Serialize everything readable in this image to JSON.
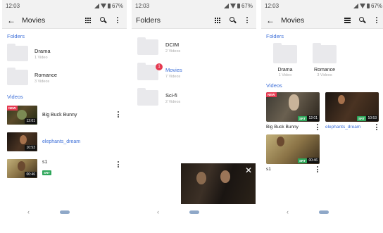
{
  "status": {
    "time": "12:03",
    "battery": "67%"
  },
  "screen1": {
    "title": "Movies",
    "folders_header": "Folders",
    "folders": [
      {
        "name": "Drama",
        "count": "1 Video"
      },
      {
        "name": "Romance",
        "count": "3 Videos"
      }
    ],
    "videos_header": "Videos",
    "videos": [
      {
        "name": "Big Buck Bunny",
        "duration": "12:01",
        "badge": "NEW",
        "srt": ""
      },
      {
        "name": "elephants_dream",
        "duration": "10:53",
        "badge": "",
        "srt": ""
      },
      {
        "name": "s1",
        "duration": "00:46",
        "badge": "",
        "srt": "SRT"
      }
    ]
  },
  "screen2": {
    "title": "Folders",
    "folders": [
      {
        "name": "DCIM",
        "count": "2 Videos",
        "badge": ""
      },
      {
        "name": "Movies",
        "count": "7 Videos",
        "badge": "1"
      },
      {
        "name": "Sci-fi",
        "count": "2 Videos",
        "badge": ""
      }
    ],
    "pip_close": "✕"
  },
  "screen3": {
    "title": "Movies",
    "folders_header": "Folders",
    "folders": [
      {
        "name": "Drama",
        "count": "1 Video"
      },
      {
        "name": "Romance",
        "count": "3 Videos"
      }
    ],
    "videos_header": "Videos",
    "videos": [
      {
        "name": "Big Buck Bunny",
        "duration": "12:01",
        "badge": "NEW",
        "srt": "SRT"
      },
      {
        "name": "elephants_dream",
        "duration": "10:53",
        "badge": "",
        "srt": "SRT"
      },
      {
        "name": "s1",
        "duration": "00:46",
        "badge": "",
        "srt": "SRT"
      }
    ]
  },
  "nav": {
    "back": "‹"
  },
  "colors": {
    "accent": "#3d6fd8",
    "new_badge": "#e53950",
    "srt_badge": "#2ea65a"
  },
  "icons": [
    "back-arrow-icon",
    "grid-view-icon",
    "list-view-icon",
    "search-icon",
    "more-vert-icon",
    "folder-icon",
    "close-icon"
  ]
}
